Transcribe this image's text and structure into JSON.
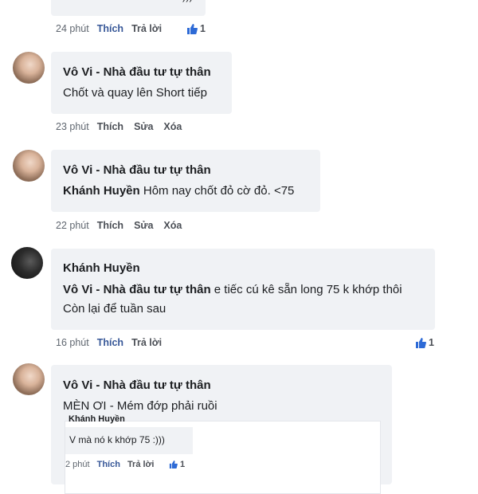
{
  "comments": [
    {
      "bubble_text": "",
      "time": "24 phút",
      "actions": [
        "Thích",
        "Trả lời"
      ],
      "likes": "1"
    },
    {
      "author": "Vô Vi - Nhà đầu tư tự thân",
      "text": "Chốt và quay lên Short tiếp",
      "time": "23 phút",
      "actions": [
        "Thích",
        "Sửa",
        "Xóa"
      ]
    },
    {
      "author": "Vô Vi - Nhà đầu tư tự thân",
      "mention": "Khánh Huyền",
      "text": "Hôm nay chốt đỏ cờ đỏ. <75",
      "time": "22 phút",
      "actions": [
        "Thích",
        "Sửa",
        "Xóa"
      ]
    },
    {
      "author": "Khánh Huyền",
      "mention": "Vô Vi - Nhà đầu tư tự thân",
      "text": "e tiếc cú kê sẵn long 75 k khớp thôi",
      "text2": "Còn lại để tuần sau",
      "time": "16 phút",
      "actions": [
        "Thích",
        "Trả lời"
      ],
      "likes": "1"
    },
    {
      "author": "Vô Vi - Nhà đầu tư tự thân",
      "text": "MÈN ƠI - Mém đớp phải ruồi",
      "quoted": {
        "author": "Khánh Huyền",
        "text": "V mà nó k khớp 75 :)))",
        "time": "2 phút",
        "actions": [
          "Thích",
          "Trả lời"
        ],
        "likes": "1"
      }
    }
  ]
}
